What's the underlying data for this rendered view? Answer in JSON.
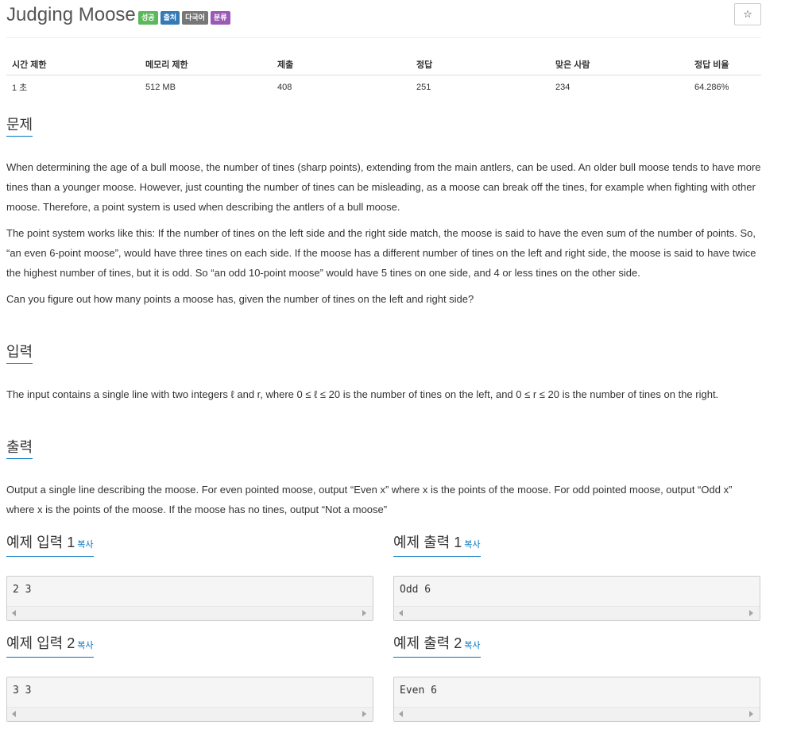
{
  "problem": {
    "title": "Judging Moose",
    "labels": [
      {
        "text": "성공",
        "color": "#5cb85c"
      },
      {
        "text": "출처",
        "color": "#337ab7"
      },
      {
        "text": "다국어",
        "color": "#777777"
      },
      {
        "text": "분류",
        "color": "#9b59b6"
      }
    ],
    "star": "☆"
  },
  "info_table": {
    "headers": [
      "시간 제한",
      "메모리 제한",
      "제출",
      "정답",
      "맞은 사람",
      "정답 비율"
    ],
    "values": [
      "1 초",
      "512 MB",
      "408",
      "251",
      "234",
      "64.286%"
    ]
  },
  "description": {
    "heading": "문제",
    "paragraphs": [
      "When determining the age of a bull moose, the number of tines (sharp points), extending from the main antlers, can be used. An older bull moose tends to have more tines than a younger moose. However, just counting the number of tines can be misleading, as a moose can break off the tines, for example when fighting with other moose. Therefore, a point system is used when describing the antlers of a bull moose.",
      "The point system works like this: If the number of tines on the left side and the right side match, the moose is said to have the even sum of the number of points. So, “an even 6-point moose”, would have three tines on each side. If the moose has a different number of tines on the left and right side, the moose is said to have twice the highest number of tines, but it is odd. So “an odd 10-point moose” would have 5 tines on one side, and 4 or less tines on the other side.",
      "Can you figure out how many points a moose has, given the number of tines on the left and right side?"
    ]
  },
  "input": {
    "heading": "입력",
    "text": "The input contains a single line with two integers ℓ and r, where 0 ≤ ℓ ≤ 20 is the number of tines on the left, and 0 ≤ r ≤ 20 is the number of tines on the right."
  },
  "output": {
    "heading": "출력",
    "text": "Output a single line describing the moose. For even pointed moose, output “Even x” where x is the points of the moose. For odd pointed moose, output “Odd x” where x is the points of the moose. If the moose has no tines, output “Not a moose”"
  },
  "samples": {
    "copy_label": "복사",
    "input1_title": "예제 입력 1",
    "input1": "2 3",
    "output1_title": "예제 출력 1",
    "output1": "Odd 6",
    "input2_title": "예제 입력 2",
    "input2": "3 3",
    "output2_title": "예제 출력 2",
    "output2": "Even 6"
  }
}
